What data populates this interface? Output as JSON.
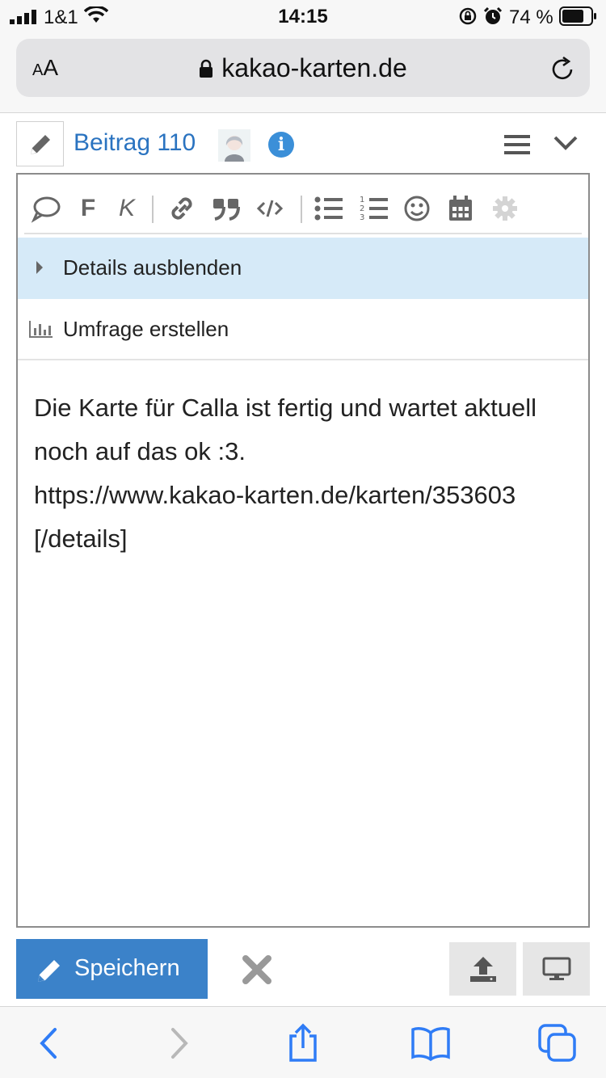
{
  "status_bar": {
    "carrier": "1&1",
    "time": "14:15",
    "battery": "74 %"
  },
  "browser": {
    "text_size_small": "A",
    "text_size_large": "A",
    "url": "kakao-karten.de"
  },
  "editor": {
    "title": "Beitrag 110",
    "details_label": "Details ausblenden",
    "poll_label": "Umfrage erstellen",
    "toolbar_bold": "F",
    "toolbar_italic": "K",
    "content": "Die Karte für Calla ist fertig und wartet aktuell noch auf das ok :3.\nhttps://www.kakao-karten.de/karten/353603\n[/details]",
    "save_label": "Speichern"
  },
  "colors": {
    "accent": "#3b82c9",
    "title_link": "#2a73c0",
    "details_bg": "#d6eaf8",
    "ios_blue": "#2f7cf6"
  },
  "icons": [
    "signal-icon",
    "wifi-icon",
    "lock-rotation-icon",
    "alarm-icon",
    "battery-icon",
    "lock-icon",
    "reload-icon",
    "pencil-icon",
    "info-icon",
    "menu-icon",
    "chevron-down-icon",
    "speech-bubble-icon",
    "link-icon",
    "quote-icon",
    "code-icon",
    "bullet-list-icon",
    "numbered-list-icon",
    "emoji-icon",
    "calendar-icon",
    "gear-icon",
    "caret-right-icon",
    "bar-chart-icon",
    "close-icon",
    "upload-icon",
    "monitor-icon",
    "back-icon",
    "forward-icon",
    "share-icon",
    "bookmarks-icon",
    "tabs-icon"
  ]
}
